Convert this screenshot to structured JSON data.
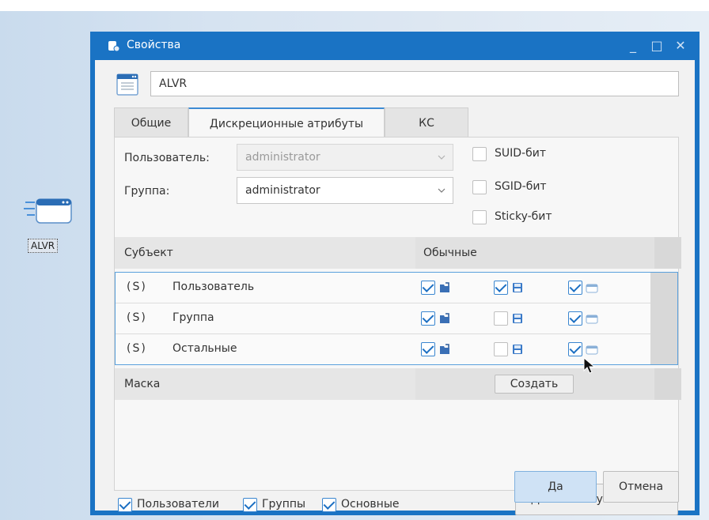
{
  "desktop": {
    "icon_label": "ALVR"
  },
  "window": {
    "title": "Свойства",
    "controls": {
      "minimize": "_",
      "maximize": "□",
      "close": "✕"
    }
  },
  "name_field": {
    "value": "ALVR"
  },
  "tabs": [
    {
      "label": "Общие",
      "active": false
    },
    {
      "label": "Дискреционные атрибуты",
      "active": true
    },
    {
      "label": "КС",
      "active": false
    }
  ],
  "owner": {
    "user_label": "Пользователь:",
    "user_value": "administrator",
    "group_label": "Группа:",
    "group_value": "administrator"
  },
  "flags": [
    {
      "label": "SUID-бит",
      "checked": false
    },
    {
      "label": "SGID-бит",
      "checked": false
    },
    {
      "label": "Sticky-бит",
      "checked": false
    }
  ],
  "table": {
    "header_subject": "Субъект",
    "header_normal": "Обычные",
    "rows": [
      {
        "tag": "(S)",
        "name": "Пользователь",
        "read": true,
        "write": true,
        "exec": true
      },
      {
        "tag": "(S)",
        "name": "Группа",
        "read": true,
        "write": false,
        "exec": true
      },
      {
        "tag": "(S)",
        "name": "Остальные",
        "read": true,
        "write": false,
        "exec": true
      }
    ],
    "mask_label": "Маска",
    "create_button": "Создать"
  },
  "filters": [
    {
      "label": "Пользователи",
      "checked": true
    },
    {
      "label": "Группы",
      "checked": true
    },
    {
      "label": "Основные",
      "checked": true
    }
  ],
  "add_acl_button": "Добавить субъект ACL",
  "ok_button": "Да",
  "cancel_button": "Отмена",
  "colors": {
    "accent": "#1a73c4",
    "selection_border": "#5aa0dc"
  }
}
